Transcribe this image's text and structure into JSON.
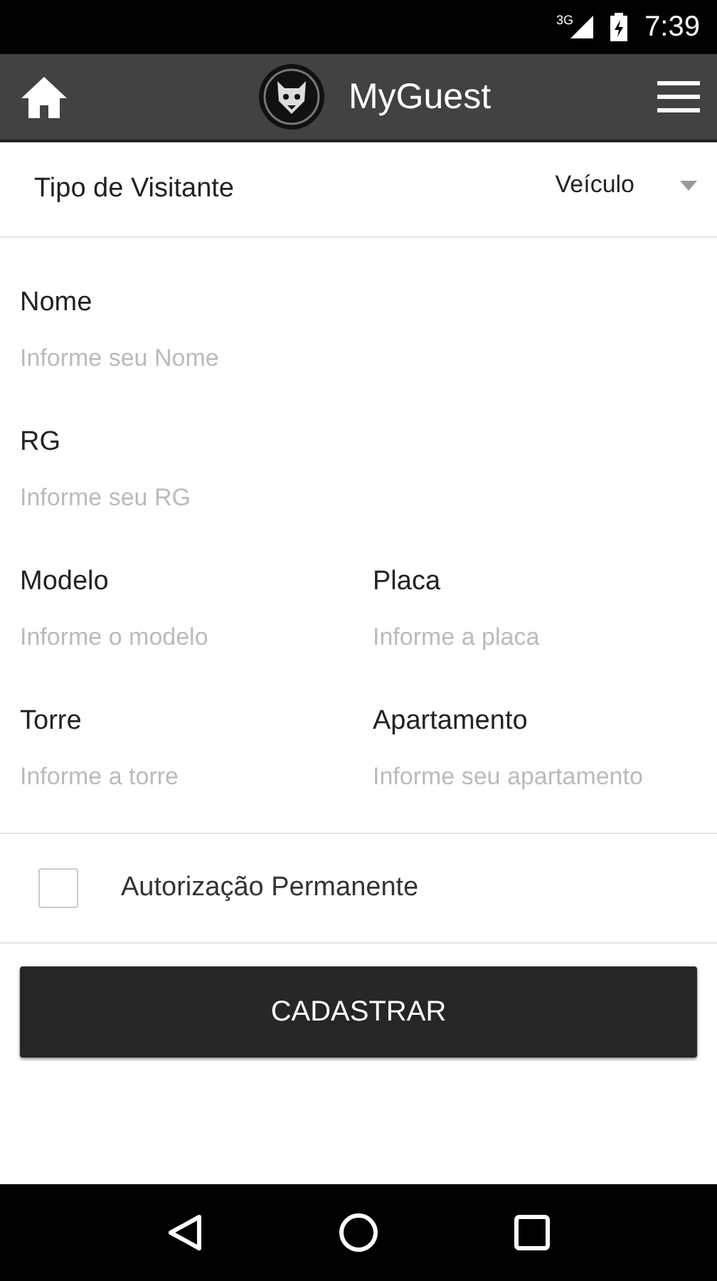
{
  "status_bar": {
    "network": "3G",
    "time": "7:39"
  },
  "app_bar": {
    "title": "MyGuest"
  },
  "visitor_type": {
    "label": "Tipo de Visitante",
    "value": "Veículo"
  },
  "form_rows": [
    [
      {
        "label": "Nome",
        "placeholder": "Informe seu Nome"
      }
    ],
    [
      {
        "label": "RG",
        "placeholder": "Informe seu RG"
      }
    ],
    [
      {
        "label": "Modelo",
        "placeholder": "Informe o modelo"
      },
      {
        "label": "Placa",
        "placeholder": "Informe a placa"
      }
    ],
    [
      {
        "label": "Torre",
        "placeholder": "Informe a torre"
      },
      {
        "label": "Apartamento",
        "placeholder": "Informe seu apartamento"
      }
    ]
  ],
  "permanent_authorization": {
    "label": "Autorização Permanente",
    "checked": false
  },
  "submit_button": "CADASTRAR"
}
